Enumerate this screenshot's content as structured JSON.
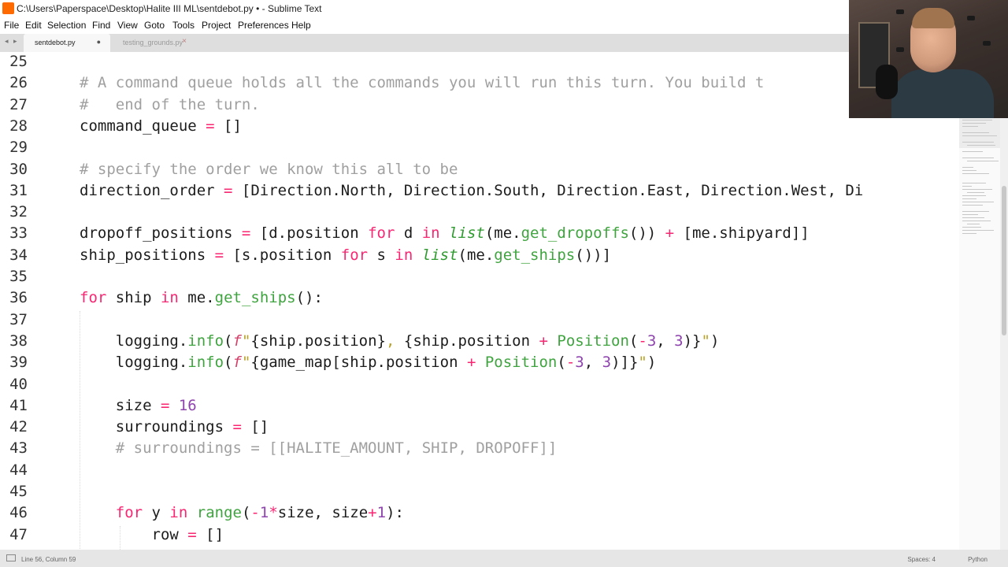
{
  "window": {
    "title": "C:\\Users\\Paperspace\\Desktop\\Halite III ML\\sentdebot.py • - Sublime Text"
  },
  "menu": [
    "File",
    "Edit",
    "Selection",
    "Find",
    "View",
    "Goto",
    "Tools",
    "Project",
    "Preferences",
    "Help"
  ],
  "tabs": [
    {
      "label": "sentdebot.py",
      "active": true,
      "modified": true
    },
    {
      "label": "testing_grounds.py",
      "active": false
    }
  ],
  "tab_nav_glyph": "◂ ▸",
  "tab_dot_glyph": "●",
  "tab_close_glyph": "×",
  "editor": {
    "lines": [
      {
        "n": "25",
        "html": ""
      },
      {
        "n": "26",
        "html": "<span class=\"c\"># A command queue holds all the commands you will run this turn. You build t</span>"
      },
      {
        "n": "27",
        "html": "<span class=\"c\">#   end of the turn.</span>"
      },
      {
        "n": "28",
        "html": "command_queue <span class=\"k\">=</span> []"
      },
      {
        "n": "29",
        "html": ""
      },
      {
        "n": "30",
        "html": "<span class=\"c\"># specify the order we know this all to be</span>"
      },
      {
        "n": "31",
        "html": "direction_order <span class=\"k\">=</span> [Direction.North, Direction.South, Direction.East, Direction.West, Di"
      },
      {
        "n": "32",
        "html": ""
      },
      {
        "n": "33",
        "html": "dropoff_positions <span class=\"k\">=</span> [d.position <span class=\"k\">for</span> d <span class=\"k\">in</span> <span class=\"it\">list</span>(me.<span class=\"f\">get_dropoffs</span>()) <span class=\"k\">+</span> [me.shipyard]]"
      },
      {
        "n": "34",
        "html": "ship_positions <span class=\"k\">=</span> [s.position <span class=\"k\">for</span> s <span class=\"k\">in</span> <span class=\"it\">list</span>(me.<span class=\"f\">get_ships</span>())]"
      },
      {
        "n": "35",
        "html": ""
      },
      {
        "n": "36",
        "html": "<span class=\"k\">for</span> ship <span class=\"k\">in</span> me.<span class=\"f\">get_ships</span>():"
      },
      {
        "n": "37",
        "html": ""
      },
      {
        "n": "38",
        "html": "    logging.<span class=\"f\">info</span>(<span class=\"sk\">f</span><span class=\"s\">\"</span>{ship.position}<span class=\"s\">, </span>{ship.position <span class=\"k\">+</span> <span class=\"f\">Position</span>(<span class=\"k\">-</span><span class=\"n\">3</span>, <span class=\"n\">3</span>)}<span class=\"s\">\"</span>)"
      },
      {
        "n": "39",
        "html": "    logging.<span class=\"f\">info</span>(<span class=\"sk\">f</span><span class=\"s\">\"</span>{game_map[ship.position <span class=\"k\">+</span> <span class=\"f\">Position</span>(<span class=\"k\">-</span><span class=\"n\">3</span>, <span class=\"n\">3</span>)]}<span class=\"s\">\"</span>)"
      },
      {
        "n": "40",
        "html": ""
      },
      {
        "n": "41",
        "html": "    size <span class=\"k\">=</span> <span class=\"n\">16</span>"
      },
      {
        "n": "42",
        "html": "    surroundings <span class=\"k\">=</span> []"
      },
      {
        "n": "43",
        "html": "    <span class=\"c\"># surroundings = [[HALITE_AMOUNT, SHIP, DROPOFF]]</span>"
      },
      {
        "n": "44",
        "html": ""
      },
      {
        "n": "45",
        "html": ""
      },
      {
        "n": "46",
        "html": "    <span class=\"k\">for</span> y <span class=\"k\">in</span> <span class=\"f\">range</span>(<span class=\"k\">-</span><span class=\"n\">1</span><span class=\"k\">*</span>size, size<span class=\"k\">+</span><span class=\"n\">1</span>):"
      },
      {
        "n": "47",
        "html": "        row <span class=\"k\">=</span> []"
      }
    ]
  },
  "status": {
    "position": "Line 56, Column 59",
    "indent": "Spaces: 4",
    "syntax": "Python"
  }
}
